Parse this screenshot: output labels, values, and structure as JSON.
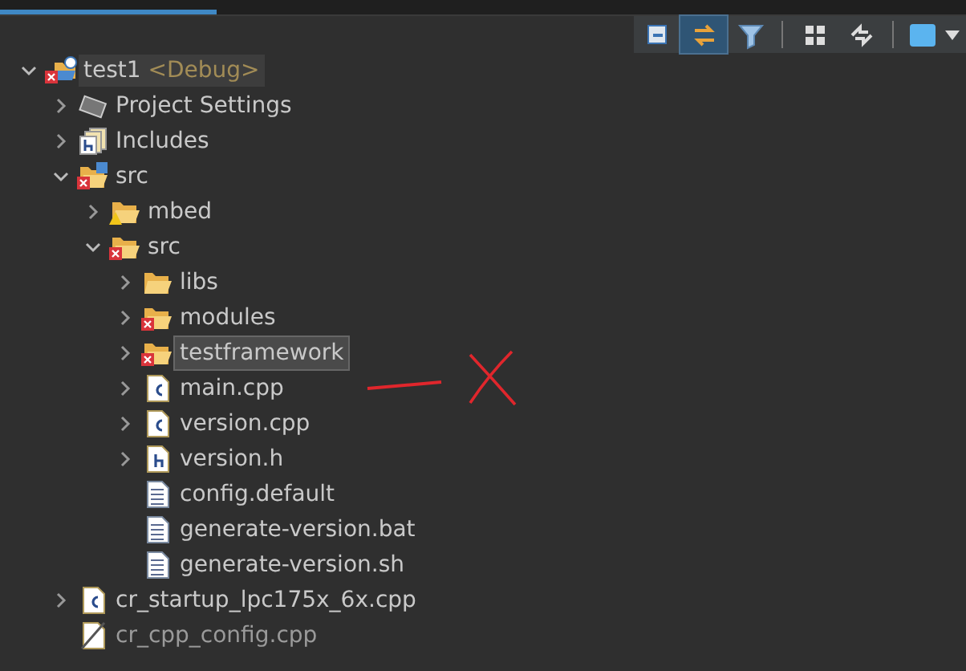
{
  "toolbar": [
    {
      "kind": "collapse",
      "pressed": false
    },
    {
      "kind": "link",
      "pressed": true
    },
    {
      "kind": "filter",
      "pressed": false
    },
    {
      "kind": "separator"
    },
    {
      "kind": "grid",
      "pressed": false
    },
    {
      "kind": "sync",
      "pressed": false
    },
    {
      "kind": "separator"
    },
    {
      "kind": "view-menu",
      "pressed": false
    }
  ],
  "tree": [
    {
      "label": "test1",
      "suffix": "<Debug>",
      "kind": "project",
      "error": true,
      "expanded": true,
      "selected": true,
      "children": [
        {
          "label": "Project Settings",
          "kind": "settings",
          "expanded": false,
          "selected": false
        },
        {
          "label": "Includes",
          "kind": "includes",
          "expanded": false,
          "selected": false
        },
        {
          "label": "src",
          "kind": "source-folder",
          "error": true,
          "expanded": true,
          "selected": false,
          "children": [
            {
              "label": "mbed",
              "kind": "folder",
              "warning": true,
              "expanded": false,
              "selected": false
            },
            {
              "label": "src",
              "kind": "folder",
              "error": true,
              "expanded": true,
              "selected": false,
              "children": [
                {
                  "label": "libs",
                  "kind": "folder",
                  "expanded": false,
                  "selected": false
                },
                {
                  "label": "modules",
                  "kind": "folder",
                  "error": true,
                  "expanded": false,
                  "selected": false
                },
                {
                  "label": "testframework",
                  "kind": "folder",
                  "error": true,
                  "expanded": false,
                  "selected": true
                },
                {
                  "label": "main.cpp",
                  "kind": "c-file",
                  "expanded": false,
                  "selected": false
                },
                {
                  "label": "version.cpp",
                  "kind": "c-file",
                  "expanded": false,
                  "selected": false
                },
                {
                  "label": "version.h",
                  "kind": "h-file",
                  "expanded": false,
                  "selected": false
                },
                {
                  "label": "config.default",
                  "kind": "text-file",
                  "selected": false
                },
                {
                  "label": "generate-version.bat",
                  "kind": "text-file",
                  "selected": false
                },
                {
                  "label": "generate-version.sh",
                  "kind": "text-file",
                  "selected": false
                }
              ]
            }
          ]
        },
        {
          "label": "cr_startup_lpc175x_6x.cpp",
          "kind": "c-file",
          "expanded": false,
          "selected": false
        },
        {
          "label": "cr_cpp_config.cpp",
          "kind": "excluded-file",
          "selected": false
        }
      ]
    }
  ],
  "annotation": {
    "kind": "strike-mark"
  }
}
